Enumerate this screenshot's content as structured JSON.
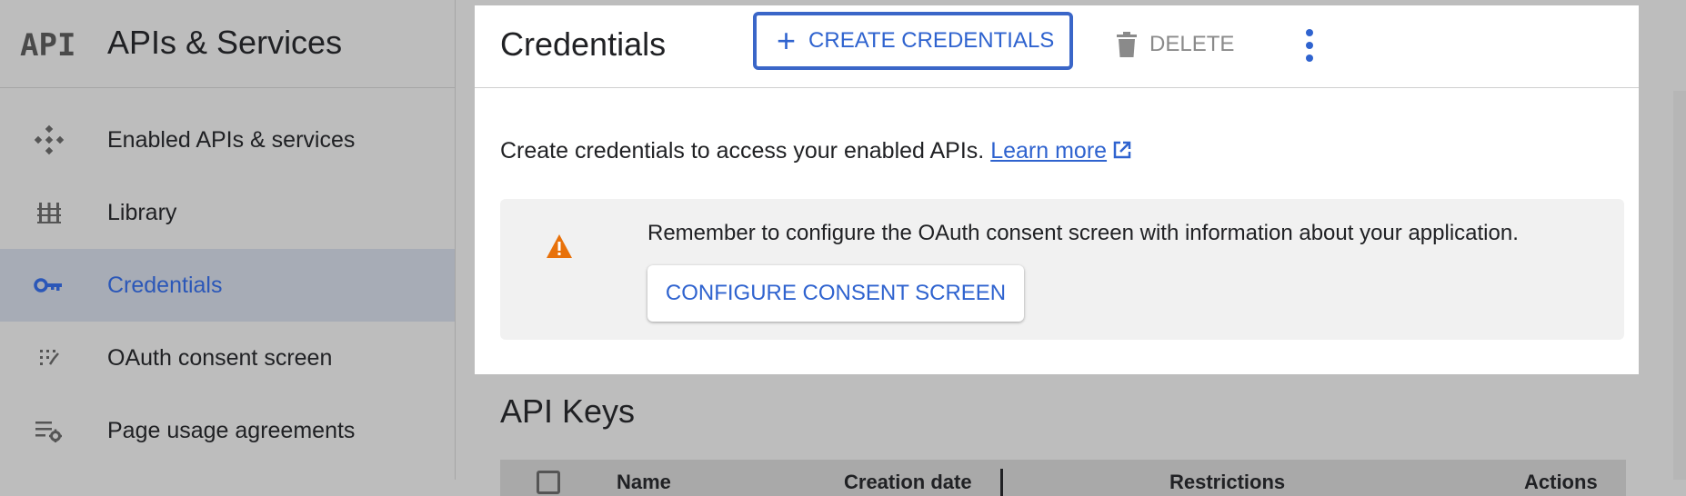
{
  "app": {
    "logo": "API",
    "title": "APIs & Services"
  },
  "sidebar": {
    "items": [
      {
        "label": "Enabled APIs & services",
        "icon": "diamond-dots-icon",
        "active": false
      },
      {
        "label": "Library",
        "icon": "library-icon",
        "active": false
      },
      {
        "label": "Credentials",
        "icon": "key-icon",
        "active": true
      },
      {
        "label": "OAuth consent screen",
        "icon": "oauth-icon",
        "active": false
      },
      {
        "label": "Page usage agreements",
        "icon": "settings-list-icon",
        "active": false
      }
    ]
  },
  "toolbar": {
    "page_title": "Credentials",
    "create_label": "CREATE CREDENTIALS",
    "delete_label": "DELETE"
  },
  "content": {
    "intro_text": "Create credentials to access your enabled APIs.",
    "learn_more": "Learn more",
    "notice_text": "Remember to configure the OAuth consent screen with information about your application.",
    "configure_label": "CONFIGURE CONSENT SCREEN"
  },
  "api_keys": {
    "title": "API Keys",
    "columns": [
      "Name",
      "Creation date",
      "Restrictions",
      "Actions"
    ]
  },
  "colors": {
    "accent": "#2f63cf",
    "warning": "#e8710a",
    "sidebar_active": "#a7acb6"
  }
}
